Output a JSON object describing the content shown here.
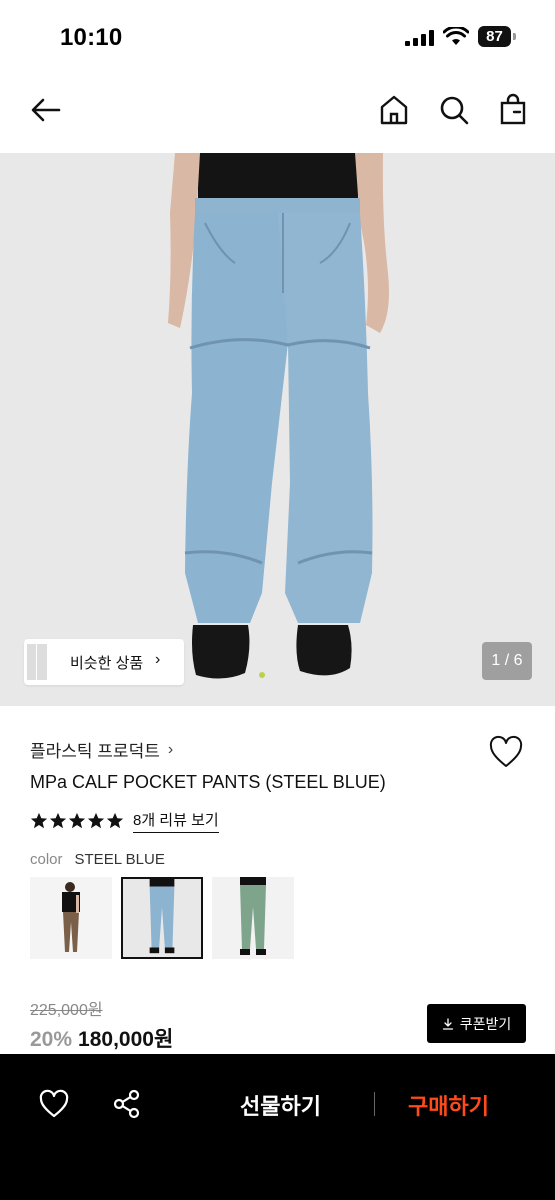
{
  "status_bar": {
    "time": "10:10",
    "battery": "87"
  },
  "nav": {
    "back_icon": "arrow-left-icon",
    "home_icon": "home-icon",
    "search_icon": "search-icon",
    "bag_icon": "shopping-bag-icon"
  },
  "gallery": {
    "similar_label": "비슷한 상품",
    "similar_chevron": "›",
    "counter": "1 / 6"
  },
  "product": {
    "brand": "플라스틱 프로덕트",
    "brand_chevron": "›",
    "title": "MPa CALF POCKET PANTS (STEEL BLUE)",
    "rating_stars": 5,
    "review_link": "8개 리뷰 보기",
    "color_label": "color",
    "color_value": "STEEL BLUE",
    "swatches": [
      {
        "name": "brown",
        "selected": false
      },
      {
        "name": "steel-blue",
        "selected": true
      },
      {
        "name": "green",
        "selected": false
      }
    ],
    "original_price": "225,000원",
    "discount": "20%",
    "sale_price": "180,000원",
    "coupon_label": "쿠폰받기"
  },
  "bottom_bar": {
    "gift_label": "선물하기",
    "buy_label": "구매하기"
  },
  "colors": {
    "buy_accent": "#ff4a1a",
    "background_dark": "#000000",
    "denim": "#8fb4cf"
  }
}
